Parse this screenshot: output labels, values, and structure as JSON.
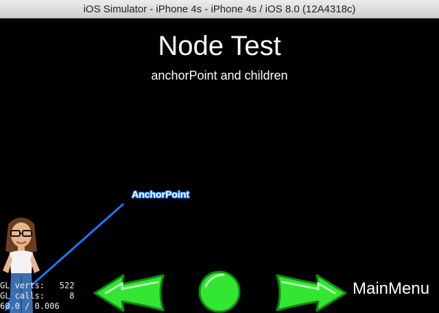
{
  "window": {
    "title": "iOS Simulator - iPhone 4s - iPhone 4s / iOS 8.0 (12A4318c)"
  },
  "scene": {
    "title": "Node Test",
    "subtitle": "anchorPoint and children",
    "anchor_label": "AnchorPoint"
  },
  "stats": {
    "line1": "GL verts:   522",
    "line2": "GL calls:     8",
    "line3": "60.0 / 0.006"
  },
  "navigation": {
    "back_icon": "left-arrow-icon",
    "restart_icon": "circle-icon",
    "next_icon": "right-arrow-icon",
    "main_menu_label": "MainMenu"
  },
  "colors": {
    "button_green": "#33e633",
    "button_outline": "#0f8a0f",
    "anchor_arrow": "#1e78ff"
  }
}
